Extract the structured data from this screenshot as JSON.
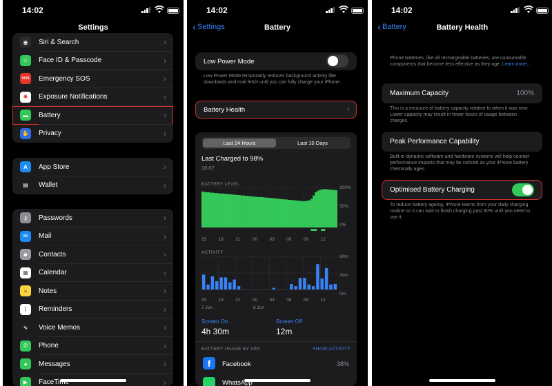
{
  "status": {
    "time": "14:02"
  },
  "settings": {
    "title": "Settings",
    "group1": [
      {
        "label": "Siri & Search",
        "icon": "siri-icon",
        "color": "#2c2c2e"
      },
      {
        "label": "Face ID & Passcode",
        "icon": "face-id-icon",
        "color": "#34c759"
      },
      {
        "label": "Emergency SOS",
        "icon": "sos-icon",
        "color": "#e5342b",
        "glyph": "SOS"
      },
      {
        "label": "Exposure Notifications",
        "icon": "exposure-icon",
        "color": "#ffffff"
      },
      {
        "label": "Battery",
        "icon": "battery-icon",
        "color": "#34c759"
      },
      {
        "label": "Privacy",
        "icon": "hand-icon",
        "color": "#2f6ee0"
      }
    ],
    "group2": [
      {
        "label": "App Store",
        "icon": "app-store-icon",
        "color": "#1c8cf3"
      },
      {
        "label": "Wallet",
        "icon": "wallet-icon",
        "color": "#1e1e1e"
      }
    ],
    "group3": [
      {
        "label": "Passwords",
        "icon": "key-icon",
        "color": "#8e8e93"
      },
      {
        "label": "Mail",
        "icon": "mail-icon",
        "color": "#1c8cf3"
      },
      {
        "label": "Contacts",
        "icon": "contacts-icon",
        "color": "#9a9aa0"
      },
      {
        "label": "Calendar",
        "icon": "calendar-icon",
        "color": "#ffffff"
      },
      {
        "label": "Notes",
        "icon": "notes-icon",
        "color": "#fbd33f"
      },
      {
        "label": "Reminders",
        "icon": "reminders-icon",
        "color": "#ffffff"
      },
      {
        "label": "Voice Memos",
        "icon": "voice-memos-icon",
        "color": "#1e1e1e"
      },
      {
        "label": "Phone",
        "icon": "phone-icon",
        "color": "#34c759"
      },
      {
        "label": "Messages",
        "icon": "messages-icon",
        "color": "#34c759"
      },
      {
        "label": "FaceTime",
        "icon": "facetime-icon",
        "color": "#34c759"
      }
    ]
  },
  "battery": {
    "back": "Settings",
    "title": "Battery",
    "low_power_label": "Low Power Mode",
    "low_power_on": false,
    "low_power_desc": "Low Power Mode temporarily reduces background activity like downloads and mail fetch until you can fully charge your iPhone.",
    "health_label": "Battery Health",
    "seg_24h": "Last 24 Hours",
    "seg_10d": "Last 10 Days",
    "last_charged": "Last Charged to 98%",
    "last_charged_time": "10:07",
    "level_label": "BATTERY LEVEL",
    "level_yticks": [
      "100%",
      "50%",
      "0%"
    ],
    "activity_label": "ACTIVITY",
    "activity_yticks": [
      "60m",
      "30m",
      "0m"
    ],
    "xticks": [
      "15",
      "18",
      "21",
      "00",
      "03",
      "06",
      "09",
      "12"
    ],
    "date1": "7 Jun",
    "date2": "8 Jun",
    "screen_on_label": "Screen On",
    "screen_on_value": "4h 30m",
    "screen_off_label": "Screen Off",
    "screen_off_value": "12m",
    "usage_label": "BATTERY USAGE BY APP",
    "show_activity": "SHOW ACTIVITY",
    "apps": [
      {
        "name": "Facebook",
        "pct": "38%"
      },
      {
        "name": "WhatsApp",
        "pct": ""
      }
    ]
  },
  "chart_data": [
    {
      "type": "bar",
      "title": "BATTERY LEVEL",
      "ylim": [
        0,
        100
      ],
      "ytick_labels": [
        "100%",
        "50%",
        "0%"
      ],
      "xtick_labels": [
        "15",
        "18",
        "21",
        "00",
        "03",
        "06",
        "09",
        "12"
      ],
      "values": [
        90,
        89,
        88,
        88,
        87,
        87,
        86,
        86,
        85,
        85,
        85,
        84,
        84,
        83,
        83,
        82,
        82,
        81,
        81,
        80,
        80,
        79,
        79,
        78,
        78,
        77,
        77,
        76,
        76,
        76,
        75,
        75,
        74,
        74,
        73,
        73,
        72,
        72,
        71,
        71,
        70,
        70,
        69,
        69,
        68,
        68,
        67,
        67,
        66,
        66,
        66,
        67,
        68,
        72,
        80,
        88,
        92,
        94,
        95,
        96,
        96,
        95,
        95,
        94,
        94,
        93
      ],
      "charging_flags": [
        0,
        0,
        0,
        0,
        0,
        0,
        0,
        0,
        0,
        0,
        0,
        0,
        0,
        0,
        0,
        0,
        0,
        0,
        0,
        0,
        0,
        0,
        0,
        0,
        0,
        0,
        0,
        0,
        0,
        0,
        0,
        0,
        0,
        0,
        0,
        0,
        0,
        0,
        0,
        0,
        0,
        0,
        0,
        0,
        0,
        0,
        0,
        0,
        0,
        0,
        0,
        0,
        0,
        1,
        1,
        1,
        0,
        0,
        1,
        1,
        0,
        0,
        0,
        0,
        0,
        0
      ],
      "color": "#34c759"
    },
    {
      "type": "bar",
      "title": "ACTIVITY",
      "ylim": [
        0,
        60
      ],
      "ytick_labels": [
        "60m",
        "30m",
        "0m"
      ],
      "xtick_labels": [
        "15",
        "18",
        "21",
        "00",
        "03",
        "06",
        "09",
        "12"
      ],
      "values": [
        27,
        9,
        24,
        15,
        22,
        22,
        13,
        18,
        6,
        0,
        0,
        0,
        0,
        0,
        0,
        0,
        3,
        0,
        0,
        0,
        10,
        6,
        21,
        21,
        9,
        6,
        46,
        20,
        39,
        9,
        10
      ],
      "color": "#3a82f7"
    }
  ],
  "health": {
    "back": "Battery",
    "title": "Battery Health",
    "intro": "Phone batteries, like all rechargeable batteries, are consumable components that become less effective as they age.",
    "learn_more": "Learn more...",
    "max_capacity_label": "Maximum Capacity",
    "max_capacity_value": "100%",
    "max_capacity_desc": "This is a measure of battery capacity relative to when it was new. Lower capacity may result in fewer hours of usage between charges.",
    "peak_label": "Peak Performance Capability",
    "peak_desc": "Built-in dynamic software and hardware systems will help counter performance impacts that may be noticed as your iPhone battery chemically ages.",
    "optimised_label": "Optimised Battery Charging",
    "optimised_on": true,
    "optimised_desc": "To reduce battery ageing, iPhone learns from your daily charging routine so it can wait to finish charging past 80% until you need to use it."
  },
  "colors": {
    "accent": "#3a82f7",
    "highlight": "#d0312d",
    "green": "#34c759"
  }
}
